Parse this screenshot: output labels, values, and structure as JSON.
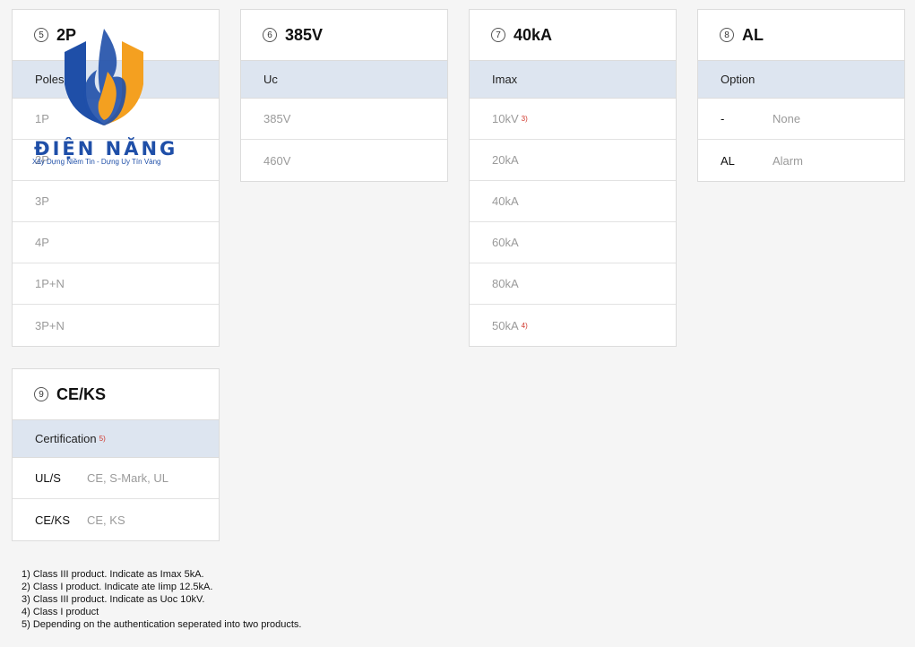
{
  "cards": {
    "poles": {
      "number": "5",
      "code": "2P",
      "header": "Poles",
      "rows": [
        "1P",
        "2P",
        "3P",
        "4P",
        "1P+N",
        "3P+N"
      ]
    },
    "voltage": {
      "number": "6",
      "code": "385V",
      "header": "Uc",
      "rows": [
        "385V",
        "460V"
      ]
    },
    "imax": {
      "number": "7",
      "code": "40kA",
      "header": "Imax",
      "rows": [
        {
          "label": "10kV",
          "note": "3)"
        },
        {
          "label": "20kA"
        },
        {
          "label": "40kA"
        },
        {
          "label": "60kA"
        },
        {
          "label": "80kA"
        },
        {
          "label": "50kA",
          "note": "4)"
        }
      ]
    },
    "option": {
      "number": "8",
      "code": "AL",
      "header": "Option",
      "rows": [
        {
          "key": "-",
          "value": "None"
        },
        {
          "key": "AL",
          "value": "Alarm"
        }
      ]
    },
    "certification": {
      "number": "9",
      "code": "CE/KS",
      "header": "Certification",
      "header_note": "5)",
      "rows": [
        {
          "key": "UL/S",
          "value": "CE, S-Mark, UL"
        },
        {
          "key": "CE/KS",
          "value": "CE, KS"
        }
      ]
    }
  },
  "notes": [
    "1) Class III product. Indicate as Imax 5kA.",
    "2) Class I product. Indicate ate Iimp 12.5kA.",
    "3) Class III product. Indicate as Uoc 10kV.",
    "4) Class I product",
    "5) Depending on the authentication seperated into two products."
  ],
  "logo": {
    "name": "ĐIỆN NĂNG",
    "slogan": "Xây Dựng Niềm Tin - Dựng Uy Tín Vàng",
    "colors": {
      "blue": "#1f4fa8",
      "orange": "#f4a020"
    }
  }
}
